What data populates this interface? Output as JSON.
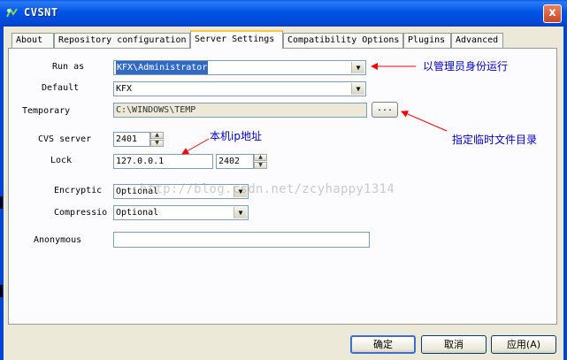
{
  "window": {
    "title": "CVSNT",
    "close_glyph": "x"
  },
  "tabs": [
    {
      "label": "About",
      "active": false
    },
    {
      "label": "Repository configuration",
      "active": false
    },
    {
      "label": "Server Settings",
      "active": true
    },
    {
      "label": "Compatibility Options",
      "active": false
    },
    {
      "label": "Plugins",
      "active": false
    },
    {
      "label": "Advanced",
      "active": false
    }
  ],
  "server_settings": {
    "run_as": {
      "label": "Run as",
      "value": "KFX\\Administrator"
    },
    "default": {
      "label": "Default",
      "value": "KFX"
    },
    "temporary": {
      "label": "Temporary",
      "value": "C:\\WINDOWS\\TEMP",
      "browse_label": "..."
    },
    "cvs_server": {
      "label": "CVS server",
      "port": "2401"
    },
    "lock": {
      "label": "Lock",
      "address": "127.0.0.1",
      "port": "2402"
    },
    "encryption": {
      "label": "Encryptic",
      "value": "Optional"
    },
    "compression": {
      "label": "Compressio",
      "value": "Optional"
    },
    "anonymous": {
      "label": "Anonymous",
      "value": ""
    }
  },
  "buttons": {
    "ok": "确定",
    "cancel": "取消",
    "apply": "应用(A)"
  },
  "annotations": {
    "run_as_note": "以管理员身份运行",
    "temp_note": "指定临时文件目录",
    "ip_note": "本机ip地址",
    "color": "#0000cc",
    "arrow_color": "#ff0000"
  },
  "watermark": "http://blog.csdn.net/zcyhappy1314",
  "icons": {
    "app": "cvsnt-app-icon",
    "close": "close-icon",
    "dropdown": "chevron-down-icon",
    "spin_up": "spin-up-icon",
    "spin_down": "spin-down-icon"
  }
}
